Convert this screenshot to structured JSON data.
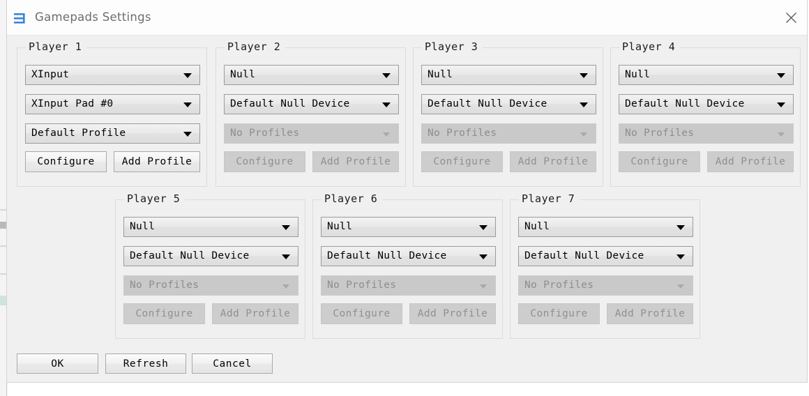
{
  "window": {
    "title": "Gamepads Settings",
    "icon": "menu-lines-icon",
    "close_label": "close-icon"
  },
  "labels": {
    "configure": "Configure",
    "add_profile": "Add Profile"
  },
  "players": [
    {
      "title": "Player 1",
      "api": "XInput",
      "device": "XInput Pad #0",
      "profile": "Default Profile",
      "profile_disabled": false,
      "buttons_disabled": false
    },
    {
      "title": "Player 2",
      "api": "Null",
      "device": "Default Null Device",
      "profile": "No Profiles",
      "profile_disabled": true,
      "buttons_disabled": true
    },
    {
      "title": "Player 3",
      "api": "Null",
      "device": "Default Null Device",
      "profile": "No Profiles",
      "profile_disabled": true,
      "buttons_disabled": true
    },
    {
      "title": "Player 4",
      "api": "Null",
      "device": "Default Null Device",
      "profile": "No Profiles",
      "profile_disabled": true,
      "buttons_disabled": true
    },
    {
      "title": "Player 5",
      "api": "Null",
      "device": "Default Null Device",
      "profile": "No Profiles",
      "profile_disabled": true,
      "buttons_disabled": true
    },
    {
      "title": "Player 6",
      "api": "Null",
      "device": "Default Null Device",
      "profile": "No Profiles",
      "profile_disabled": true,
      "buttons_disabled": true
    },
    {
      "title": "Player 7",
      "api": "Null",
      "device": "Default Null Device",
      "profile": "No Profiles",
      "profile_disabled": true,
      "buttons_disabled": true
    }
  ],
  "footer": {
    "ok": "OK",
    "refresh": "Refresh",
    "cancel": "Cancel"
  },
  "colors": {
    "window_bg": "#f0f0f0",
    "titlebar_bg": "#fdfdfd",
    "title_text": "#6d6d6d",
    "icon_blue": "#3b82d9",
    "disabled_fill": "#c9c9c9",
    "disabled_text": "#8d8d8d"
  }
}
